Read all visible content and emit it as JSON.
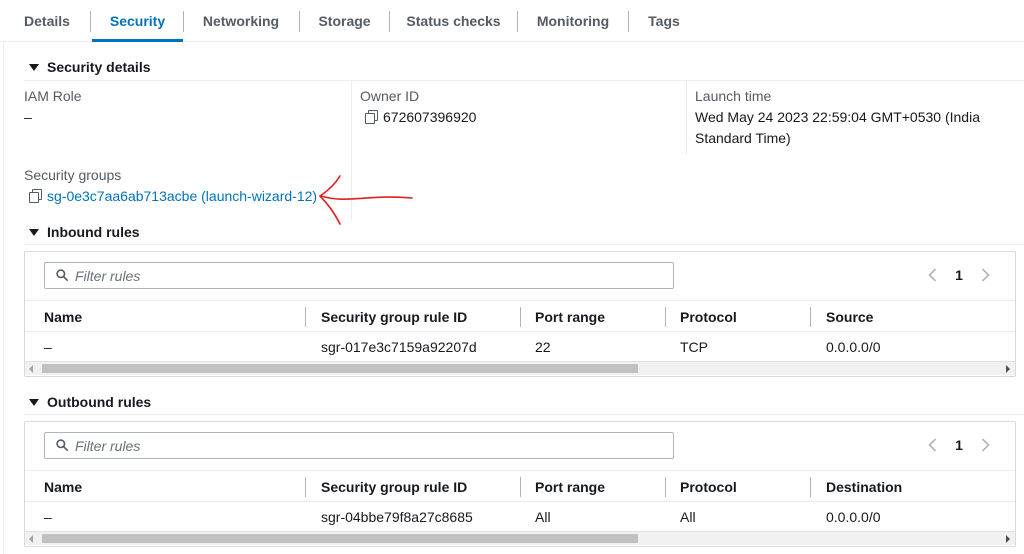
{
  "tabs": [
    {
      "label": "Details"
    },
    {
      "label": "Security"
    },
    {
      "label": "Networking"
    },
    {
      "label": "Storage"
    },
    {
      "label": "Status checks"
    },
    {
      "label": "Monitoring"
    },
    {
      "label": "Tags"
    }
  ],
  "active_tab": "Security",
  "security_details": {
    "header": "Security details",
    "iam_role_label": "IAM Role",
    "iam_role_value": "–",
    "owner_id_label": "Owner ID",
    "owner_id_value": "672607396920",
    "launch_time_label": "Launch time",
    "launch_time_line1": "Wed May 24 2023 22:59:04 GMT+0530 (India",
    "launch_time_line2": "Standard Time)",
    "security_groups_label": "Security groups",
    "security_group_link": "sg-0e3c7aa6ab713acbe (launch-wizard-12)"
  },
  "inbound_rules": {
    "header": "Inbound rules",
    "filter_placeholder": "Filter rules",
    "page": "1",
    "columns": [
      "Name",
      "Security group rule ID",
      "Port range",
      "Protocol",
      "Source"
    ],
    "rows": [
      {
        "name": "–",
        "rule_id": "sgr-017e3c7159a92207d",
        "port_range": "22",
        "protocol": "TCP",
        "source": "0.0.0.0/0"
      }
    ]
  },
  "outbound_rules": {
    "header": "Outbound rules",
    "filter_placeholder": "Filter rules",
    "page": "1",
    "columns": [
      "Name",
      "Security group rule ID",
      "Port range",
      "Protocol",
      "Destination"
    ],
    "rows": [
      {
        "name": "–",
        "rule_id": "sgr-04bbe79f8a27c8685",
        "port_range": "All",
        "protocol": "All",
        "destination": "0.0.0.0/0"
      }
    ]
  },
  "colors": {
    "link": "#0073bb",
    "active_tab": "#0073bb",
    "annotation": "#e0201e"
  }
}
